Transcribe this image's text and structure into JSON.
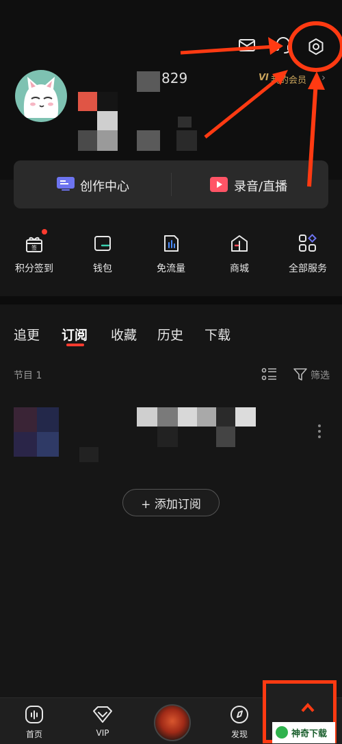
{
  "profile": {
    "id_suffix": "829",
    "vip_link": "我的会员"
  },
  "quick_actions": [
    {
      "label": "创作中心"
    },
    {
      "label": "录音/直播"
    }
  ],
  "services": [
    {
      "label": "积分签到",
      "icon": "gift-icon",
      "badge_dot": true,
      "badge_text": "签"
    },
    {
      "label": "钱包",
      "icon": "wallet-icon"
    },
    {
      "label": "免流量",
      "icon": "data-icon"
    },
    {
      "label": "商城",
      "icon": "shop-icon"
    },
    {
      "label": "全部服务",
      "icon": "grid-icon"
    }
  ],
  "tabs": [
    {
      "label": "追更"
    },
    {
      "label": "订阅",
      "active": true
    },
    {
      "label": "收藏"
    },
    {
      "label": "历史"
    },
    {
      "label": "下载"
    }
  ],
  "list": {
    "count_label": "节目 1",
    "filter_label": "筛选"
  },
  "add_subscription": "+ 添加订阅",
  "bottom_nav": [
    {
      "label": "首页",
      "icon": "home-icon"
    },
    {
      "label": "VIP",
      "icon": "vip-diamond-icon"
    },
    {
      "label": "",
      "icon": "center-avatar"
    },
    {
      "label": "发现",
      "icon": "discover-icon"
    },
    {
      "label": "",
      "icon": "watermark"
    }
  ],
  "watermark": {
    "text": "神奇下载"
  },
  "colors": {
    "accent_red": "#ff3b2f",
    "annotation": "#ff3a12",
    "vip_gold": "#c9a45c"
  }
}
